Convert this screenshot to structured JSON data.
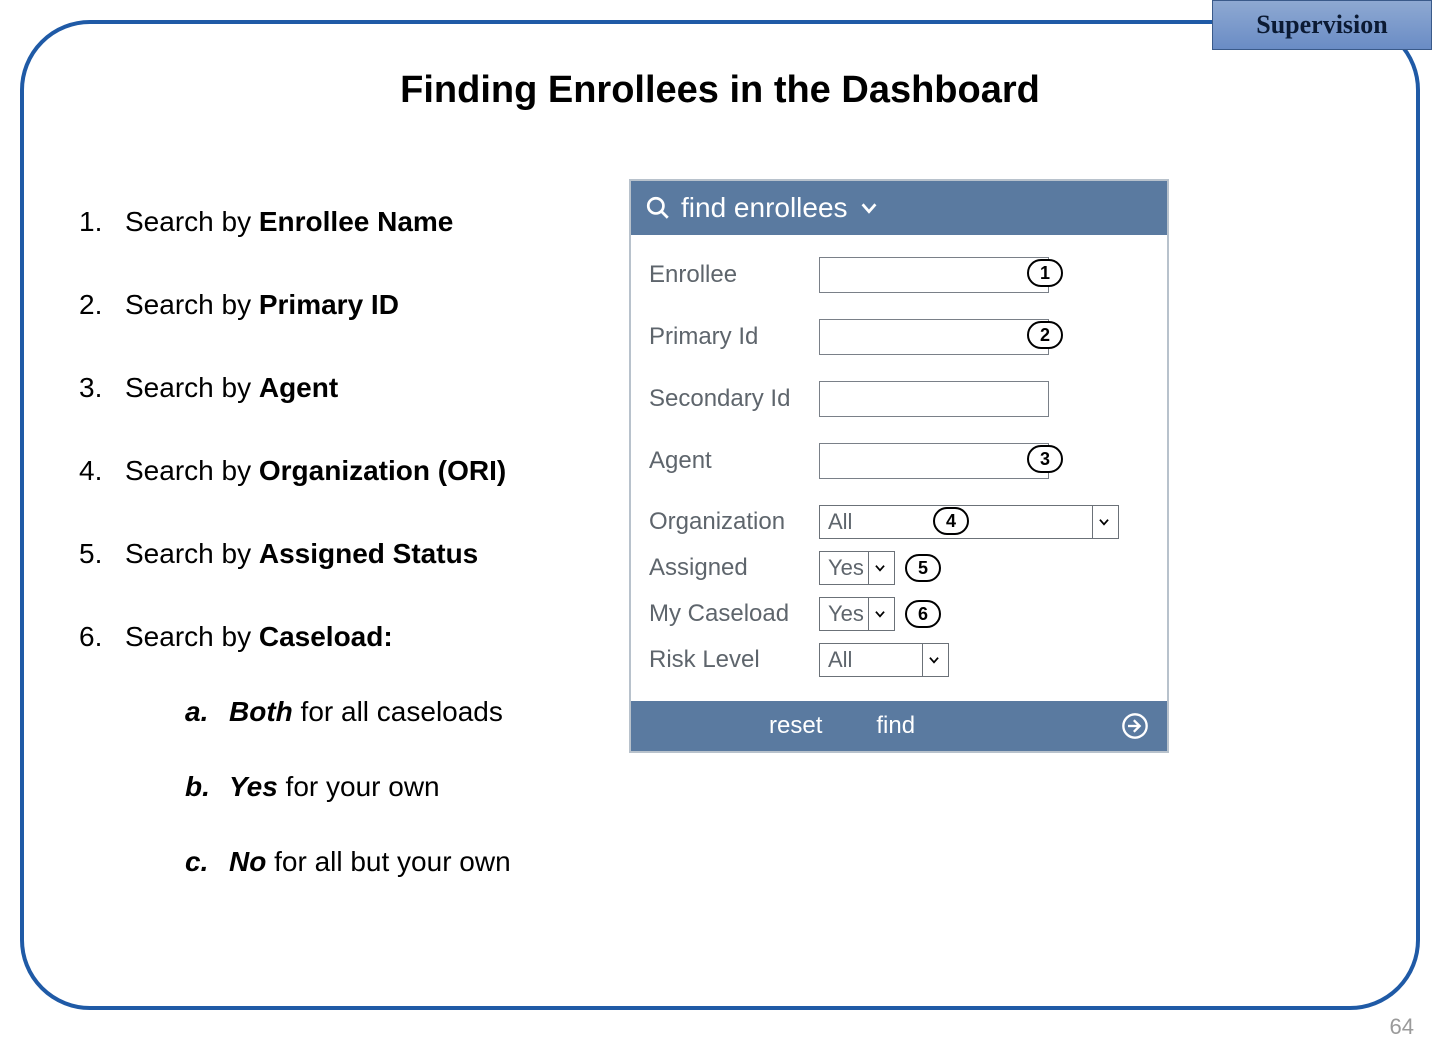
{
  "tag": "Supervision",
  "title": "Finding Enrollees in the Dashboard",
  "pageNumber": "64",
  "steps": [
    {
      "prefix": "Search by ",
      "bold": "Enrollee Name"
    },
    {
      "prefix": "Search by ",
      "bold": "Primary ID"
    },
    {
      "prefix": "Search by ",
      "bold": "Agent"
    },
    {
      "prefix": "Search by ",
      "bold": "Organization (ORI)"
    },
    {
      "prefix": "Search by ",
      "bold": "Assigned Status"
    },
    {
      "prefix": "Search by ",
      "bold": "Caseload:"
    }
  ],
  "subs": [
    {
      "letter": "a.",
      "boldItalic": "Both",
      "rest": " for all caseloads"
    },
    {
      "letter": "b.",
      "boldItalic": "Yes",
      "rest": " for your own"
    },
    {
      "letter": "c.",
      "boldItalic": "No",
      "rest": " for all but your own"
    }
  ],
  "panel": {
    "headerText": "find enrollees",
    "rows": {
      "enrollee": {
        "label": "Enrollee",
        "callout": "1"
      },
      "primaryId": {
        "label": "Primary Id",
        "callout": "2"
      },
      "secondaryId": {
        "label": "Secondary Id"
      },
      "agent": {
        "label": "Agent",
        "callout": "3"
      },
      "organization": {
        "label": "Organization",
        "value": "All",
        "callout": "4"
      },
      "assigned": {
        "label": "Assigned",
        "value": "Yes",
        "callout": "5"
      },
      "myCaseload": {
        "label": "My Caseload",
        "value": "Yes",
        "callout": "6"
      },
      "riskLevel": {
        "label": "Risk Level",
        "value": "All"
      }
    },
    "footer": {
      "reset": "reset",
      "find": "find"
    }
  }
}
